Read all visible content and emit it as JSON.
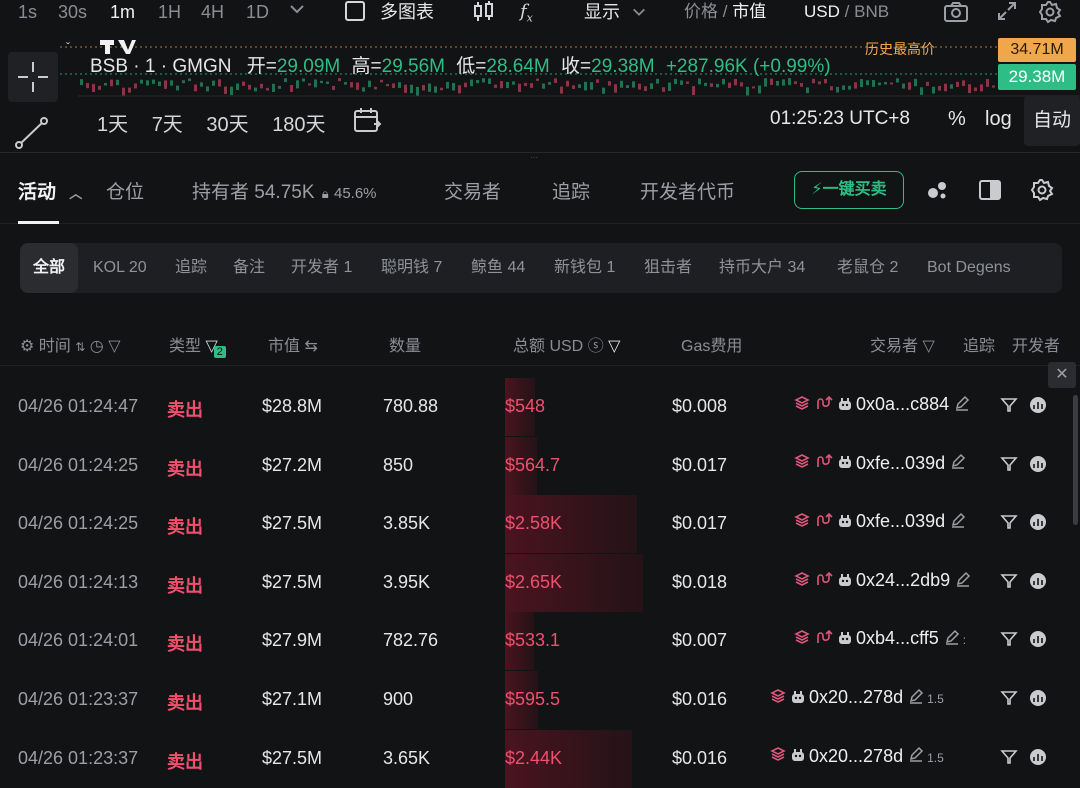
{
  "toolbar": {
    "intervals": [
      "1s",
      "30s",
      "1m",
      "1H",
      "4H",
      "1D"
    ],
    "active_interval": "1m",
    "multi_chart_label": "多图表",
    "display_label": "显示",
    "price_label": "价格",
    "separator": "/",
    "mcap_label": "市值",
    "currency_usd": "USD",
    "currency_bnb": "BNB"
  },
  "chart": {
    "symbol": "BSB · 1 · GMGN",
    "open_label": "开=",
    "open": "29.09M",
    "high_label": "高=",
    "high": "29.56M",
    "low_label": "低=",
    "low": "28.64M",
    "close_label": "收=",
    "close": "29.38M",
    "change": "+287.96K (+0.99%)",
    "ath_label": "历史最高价",
    "ath_value": "34.71M",
    "last_value": "29.38M",
    "ranges": [
      "1天",
      "7天",
      "30天",
      "180天"
    ],
    "clock": "01:25:23 UTC+8",
    "pct_label": "%",
    "log_label": "log",
    "auto_label": "自动",
    "colors": {
      "up": "#2ebd85",
      "down": "#f0506e",
      "ath": "#f0a64a"
    }
  },
  "tabs": {
    "activity": "活动",
    "positions": "仓位",
    "holders": "持有者 54.75K",
    "holders_pct": "45.6%",
    "traders": "交易者",
    "tracking": "追踪",
    "dev_tokens": "开发者代币",
    "buy_button": "一键买卖"
  },
  "chips": [
    "全部",
    "KOL 20",
    "追踪",
    "备注",
    "开发者 1",
    "聪明钱 7",
    "鲸鱼 44",
    "新钱包 1",
    "狙击者",
    "持币大户 34",
    "老鼠仓 2",
    "Bot Degens"
  ],
  "table": {
    "headers": {
      "time": "时间",
      "type": "类型",
      "type_badge": "2",
      "mcap": "市值",
      "qty": "数量",
      "total": "总额 USD",
      "gas": "Gas费用",
      "trader": "交易者",
      "track": "追踪",
      "dev": "开发者"
    },
    "rows": [
      {
        "time": "04/26 01:24:47",
        "type": "卖出",
        "mcap": "$28.8M",
        "qty": "780.88",
        "total": "$548",
        "gas": "$0.008",
        "trader": "0x0a...c884",
        "extra": "",
        "bar": 0.22
      },
      {
        "time": "04/26 01:24:25",
        "type": "卖出",
        "mcap": "$27.2M",
        "qty": "850",
        "total": "$564.7",
        "gas": "$0.017",
        "trader": "0xfe...039d",
        "extra": "",
        "bar": 0.23
      },
      {
        "time": "04/26 01:24:25",
        "type": "卖出",
        "mcap": "$27.5M",
        "qty": "3.85K",
        "total": "$2.58K",
        "gas": "$0.017",
        "trader": "0xfe...039d",
        "extra": "",
        "bar": 0.96
      },
      {
        "time": "04/26 01:24:13",
        "type": "卖出",
        "mcap": "$27.5M",
        "qty": "3.95K",
        "total": "$2.65K",
        "gas": "$0.018",
        "trader": "0x24...2db9",
        "extra": "",
        "bar": 1.0
      },
      {
        "time": "04/26 01:24:01",
        "type": "卖出",
        "mcap": "$27.9M",
        "qty": "782.76",
        "total": "$533.1",
        "gas": "$0.007",
        "trader": "0xb4...cff5",
        "extra": ":",
        "bar": 0.21
      },
      {
        "time": "04/26 01:23:37",
        "type": "卖出",
        "mcap": "$27.1M",
        "qty": "900",
        "total": "$595.5",
        "gas": "$0.016",
        "trader": "0x20...278d",
        "extra": "1.5",
        "bar": 0.24
      },
      {
        "time": "04/26 01:23:37",
        "type": "卖出",
        "mcap": "$27.5M",
        "qty": "3.65K",
        "total": "$2.44K",
        "gas": "$0.016",
        "trader": "0x20...278d",
        "extra": "1.5",
        "bar": 0.92
      }
    ]
  }
}
